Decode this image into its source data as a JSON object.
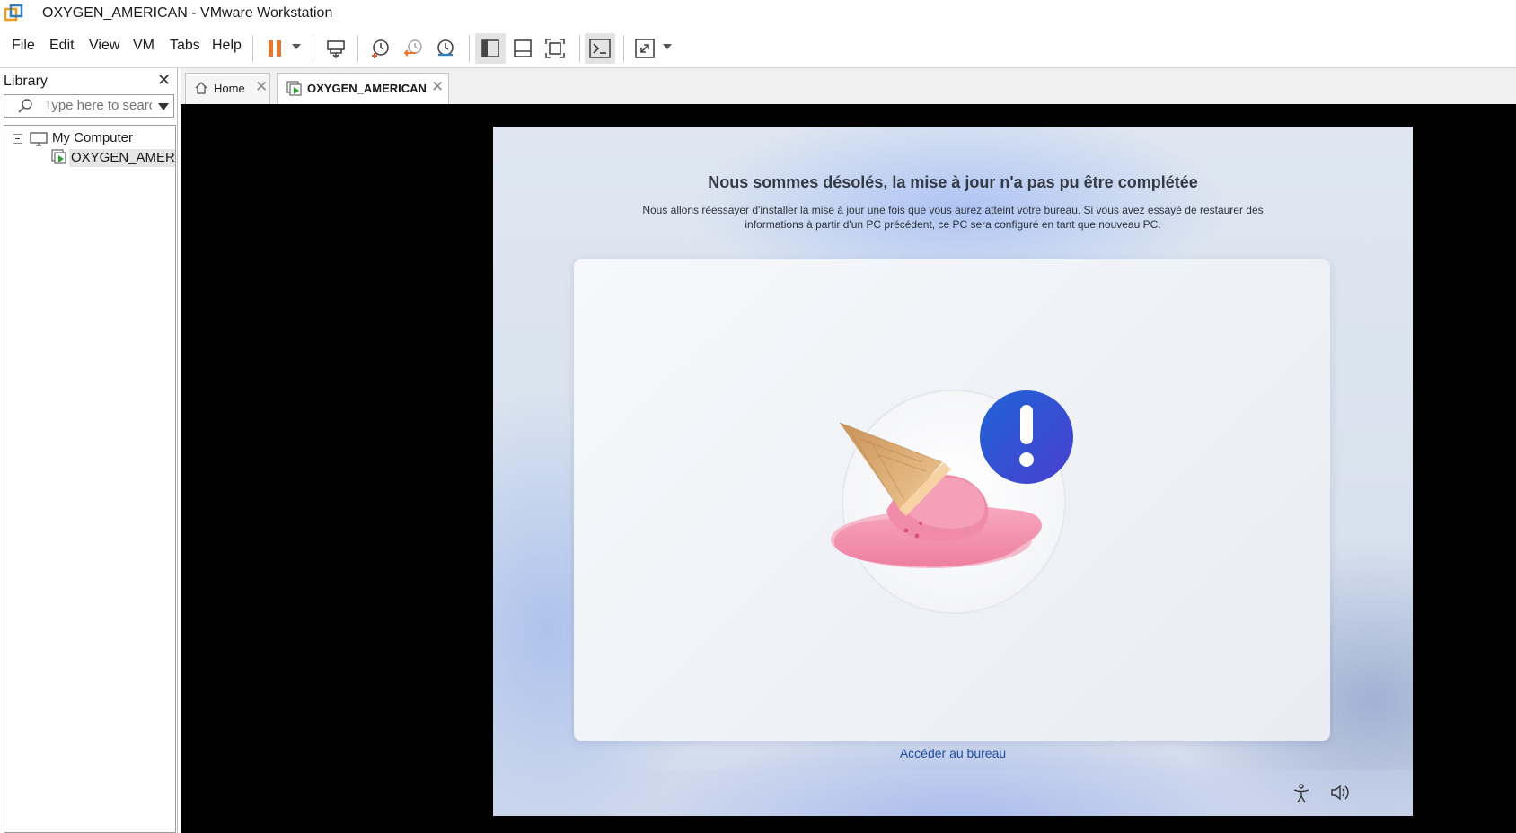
{
  "window": {
    "title": "OXYGEN_AMERICAN - VMware Workstation",
    "logo_icon": "vmware-logo"
  },
  "menu": {
    "items": [
      "File",
      "Edit",
      "View",
      "VM",
      "Tabs",
      "Help"
    ]
  },
  "toolbar": {
    "icons": [
      "pause-icon",
      "dropdown-arrow",
      "send-ctrl-alt-del-icon",
      "snapshot-icon",
      "revert-snapshot-icon",
      "snapshot-manager-icon",
      "show-library-icon",
      "thumbnail-bar-icon",
      "full-screen-icon",
      "console-view-icon",
      "stretch-guest-icon",
      "dropdown-arrow"
    ],
    "accent_color": "#e8772e"
  },
  "library": {
    "title": "Library",
    "search_placeholder": "Type here to search",
    "tree": {
      "root_label": "My Computer",
      "vm_label": "OXYGEN_AMERIC"
    }
  },
  "tabs": [
    {
      "label": "Home",
      "active": false,
      "icon": "home-icon"
    },
    {
      "label": "OXYGEN_AMERICAN",
      "active": true,
      "icon": "vm-running-icon"
    }
  ],
  "guest": {
    "title": "Nous sommes désolés, la mise à jour n'a pas pu être complétée",
    "subtitle": "Nous allons réessayer d'installer la mise à jour une fois que vous aurez atteint votre bureau. Si vous avez essayé de restaurer des informations à partir d'un PC précédent, ce PC sera configuré en tant que nouveau PC.",
    "link": "Accéder au bureau",
    "illustration": "melted-ice-cream-with-alert",
    "bottom_icons": [
      "accessibility-icon",
      "volume-icon"
    ],
    "link_color": "#1d4fa3",
    "alert_color": "#2b54d6"
  }
}
